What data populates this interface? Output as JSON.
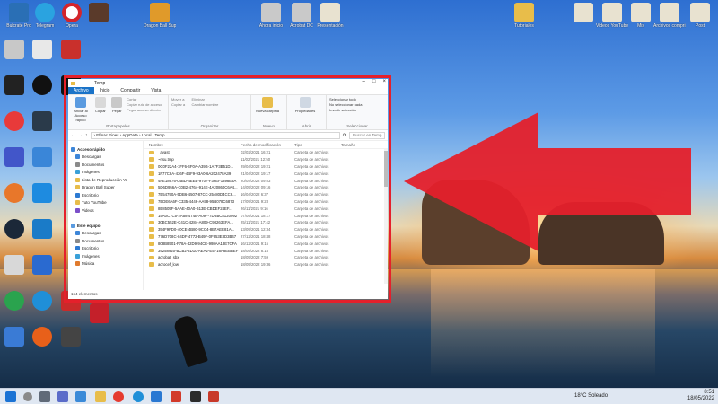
{
  "explorer": {
    "title": "Temp",
    "tabs": [
      "Archivo",
      "Inicio",
      "Compartir",
      "Vista"
    ],
    "ribbon": {
      "portapapeles": {
        "label": "Portapapeles",
        "anclar": "Anclar al Acceso rápido",
        "copiar": "Copiar",
        "pegar": "Pegar",
        "cortar": "Cortar",
        "copiar_ruta": "Copiar ruta de acceso",
        "pegar_acceso": "Pegar acceso directo"
      },
      "organizar": {
        "label": "Organizar",
        "mover": "Mover a",
        "copiar_a": "Copiar a",
        "eliminar": "Eliminar",
        "cambiar_nombre": "Cambiar nombre"
      },
      "nuevo": {
        "label": "Nuevo",
        "nueva_carpeta": "Nueva carpeta"
      },
      "abrir": {
        "label": "Abrir",
        "propiedades": "Propiedades"
      },
      "seleccionar": {
        "label": "Seleccionar",
        "todo": "Seleccionar todo",
        "nada": "No seleccionar nada",
        "invertir": "Invertir selección"
      }
    },
    "address": {
      "path": "›  Efmac Eines  ›  AppData  ›  Local  ›  Temp",
      "search_placeholder": "Buscar en Temp"
    },
    "nav": [
      {
        "label": "Acceso rápido",
        "color": "#3d86d8"
      },
      {
        "label": "Descargas",
        "color": "#3d86d8"
      },
      {
        "label": "Documentos",
        "color": "#8a8a8a"
      },
      {
        "label": "Imágenes",
        "color": "#3aa0d8"
      },
      {
        "label": "Lista de Reproducción Ye",
        "color": "#e8bd4a"
      },
      {
        "label": "Dragon Ball Super",
        "color": "#e8bd4a"
      },
      {
        "label": "Escritorio",
        "color": "#2d7ad2"
      },
      {
        "label": "Tuto YouTube",
        "color": "#e8bd4a"
      },
      {
        "label": "Videos",
        "color": "#7b4fc9"
      },
      {
        "label": "",
        "color": "#ffffff"
      },
      {
        "label": "Este equipo",
        "color": "#5a9be0"
      },
      {
        "label": "Descargas",
        "color": "#3d86d8"
      },
      {
        "label": "Documentos",
        "color": "#8a8a8a"
      },
      {
        "label": "Escritorio",
        "color": "#2d7ad2"
      },
      {
        "label": "Imágenes",
        "color": "#3aa0d8"
      },
      {
        "label": "Música",
        "color": "#e07b2e"
      }
    ],
    "columns": {
      "name": "Nombre",
      "date": "Fecha de modificación",
      "type": "Tipo",
      "size": "Tamaño"
    },
    "files": [
      {
        "name": "_avast_",
        "date": "02/02/2021 16:21",
        "type": "Carpeta de archivos"
      },
      {
        "name": "~nsu.tmp",
        "date": "11/02/2021 12:50",
        "type": "Carpeta de archivos"
      },
      {
        "name": "0C0F22A4-1FF6-4F0A-A39B-1A7F3B51D...",
        "date": "29/04/2022 19:21",
        "type": "Carpeta de archivos"
      },
      {
        "name": "1F77C8A-436F-4BF9-93A0-6A202478A39",
        "date": "21/04/2022 19:17",
        "type": "Carpeta de archivos"
      },
      {
        "name": "4FE18676-04BD-4EEE-9707-F36EF1398E3A",
        "date": "20/04/2022 09:03",
        "type": "Carpeta de archivos"
      },
      {
        "name": "5D6D956A-C0B2-4764-914E-4A20860C6A4...",
        "date": "14/05/2022 09:16",
        "type": "Carpeta de archivos"
      },
      {
        "name": "7E54790A-5DB6-4507-87CC-25480D4CC6...",
        "date": "16/04/2022 6:37",
        "type": "Carpeta de archivos"
      },
      {
        "name": "7EDE6A6F-C335-4446-AA98-95B078C6873",
        "date": "17/09/2021 9:23",
        "type": "Carpeta de archivos"
      },
      {
        "name": "8B8505F-5AAE-40A0-B13E-CBDEF24EF...",
        "date": "26/11/2021 9:16",
        "type": "Carpeta de archivos"
      },
      {
        "name": "15A0C7C5-2A58-474B-A09F-7DBBC8120092",
        "date": "07/05/2021 18:17",
        "type": "Carpeta de archivos"
      },
      {
        "name": "30BC552E-C41C-4284-A809-C98263EFA...",
        "date": "25/11/2021 17:42",
        "type": "Carpeta de archivos"
      },
      {
        "name": "354F9FD0-40CE-4B80-9CC4-8B7AEE81A...",
        "date": "13/09/2021 12:34",
        "type": "Carpeta de archivos"
      },
      {
        "name": "776D708C-84DF-4772-B49F-0F953E3D3B47",
        "date": "27/12/2021 18:48",
        "type": "Carpeta de archivos"
      },
      {
        "name": "808B8501-F78A-42D9-94CE-998AA18E7CFA",
        "date": "16/12/2021 9:15",
        "type": "Carpeta de archivos"
      },
      {
        "name": "39258920-BCB2-4D10-AEA2-E5F16A8EBBEF",
        "date": "18/05/2022 8:15",
        "type": "Carpeta de archivos"
      },
      {
        "name": "acrobat_sbx",
        "date": "18/05/2022 7:59",
        "type": "Carpeta de archivos"
      },
      {
        "name": "acrocef_low",
        "date": "18/05/2022 19:36",
        "type": "Carpeta de archivos"
      }
    ],
    "status": "164 elementos"
  },
  "desktop_icons": [
    {
      "label": "Bulcrate Pro",
      "color": "#2a6fb5"
    },
    {
      "label": "Telegram",
      "color": "#2aa3e0"
    },
    {
      "label": "Opera",
      "color": "#d4252b"
    },
    {
      "label": "",
      "color": "#5a3a2a"
    },
    {
      "label": "Dragon Ball Super",
      "color": "#e09a2a"
    },
    {
      "label": "Ahora inicio",
      "color": "#c9c9c9"
    },
    {
      "label": "Acrobat DC",
      "color": "#c9c9c9"
    },
    {
      "label": "Presentación",
      "color": "#e8e2d0"
    },
    {
      "label": "Tutoriales",
      "color": "#e8bd4a"
    },
    {
      "label": "",
      "color": "#e8e2d0"
    },
    {
      "label": "Videos YouTube",
      "color": "#e8e2d0"
    },
    {
      "label": "Mis",
      "color": "#e8e2d0"
    },
    {
      "label": "Archivos comprimir",
      "color": "#e8e2d0"
    },
    {
      "label": "Post",
      "color": "#e8e2d0"
    }
  ],
  "taskbar": {
    "weather": "18°C Soleado",
    "time": "8:51",
    "date": "18/05/2022"
  }
}
